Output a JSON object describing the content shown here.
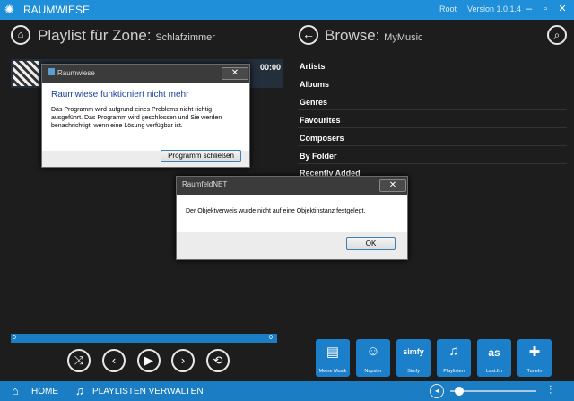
{
  "app": {
    "title": "RAUMWIESE",
    "user": "Root",
    "version": "Version 1.0.1.4"
  },
  "left": {
    "heading": "Playlist für Zone:",
    "zone": "Schlafzimmer",
    "track_time": "00:00",
    "progress_start": "0",
    "progress_end": "0"
  },
  "right": {
    "heading": "Browse:",
    "source": "MyMusic",
    "items": [
      "Artists",
      "Albums",
      "Genres",
      "Favourites",
      "Composers",
      "By Folder",
      "Recently Added"
    ]
  },
  "dialog1": {
    "window_title": "Raumwiese",
    "heading": "Raumwiese funktioniert nicht mehr",
    "message": "Das Programm wird aufgrund eines Problems nicht richtig ausgeführt. Das Programm wird geschlossen und Sie werden benachrichtigt, wenn eine Lösung verfügbar ist.",
    "button": "Programm schließen"
  },
  "dialog2": {
    "window_title": "RaumfeldNET",
    "message": "Der Objektverweis wurde nicht auf eine Objektinstanz festgelegt.",
    "button": "OK"
  },
  "tiles": [
    {
      "label": "Meine Musik",
      "icon": "music-library-icon"
    },
    {
      "label": "Napster",
      "icon": "napster-icon",
      "glyph": "☺"
    },
    {
      "label": "Simfy",
      "icon": "simfy-icon",
      "glyph": "simfy"
    },
    {
      "label": "Playlisten",
      "icon": "playlist-icon",
      "glyph": "♫"
    },
    {
      "label": "Last.fm",
      "icon": "lastfm-icon",
      "glyph": "as"
    },
    {
      "label": "TuneIn",
      "icon": "tunein-icon",
      "glyph": "✚"
    }
  ],
  "bottom": {
    "home": "HOME",
    "playlists": "PLAYLISTEN VERWALTEN",
    "volume": 0.1
  },
  "colors": {
    "accent": "#1e8fd8",
    "background": "#1d1d1d"
  }
}
